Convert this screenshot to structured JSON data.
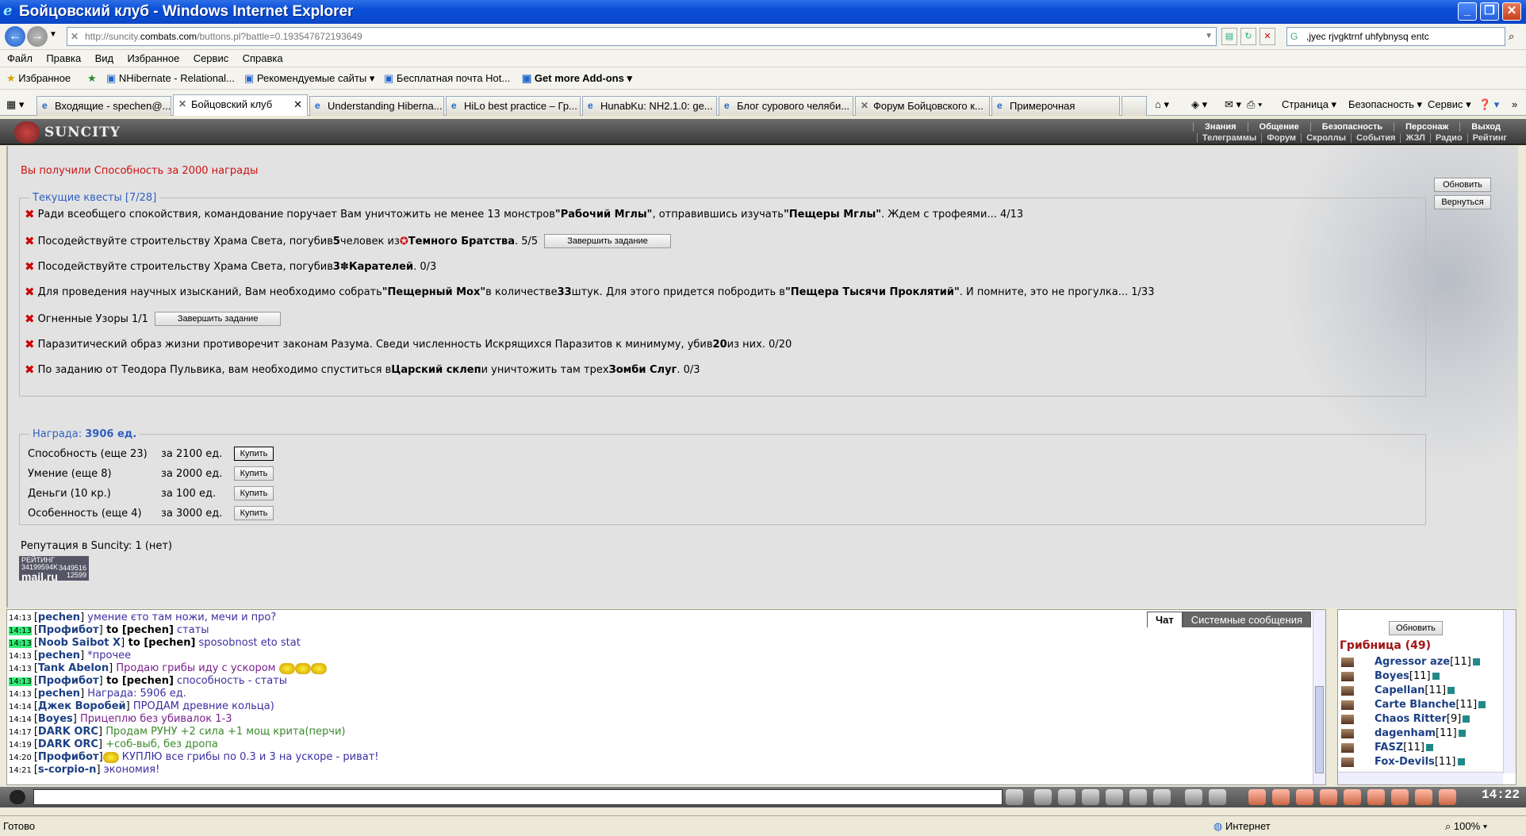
{
  "window": {
    "title": "Бойцовский клуб - Windows Internet Explorer"
  },
  "address": {
    "url_prefix": "http://suncity.",
    "url_domain": "combats.com",
    "url_suffix": "/buttons.pl?battle=0.193547672193649",
    "search_value": ",jyec rjvgktrnf uhfybnysq entc"
  },
  "menu": [
    "Файл",
    "Правка",
    "Вид",
    "Избранное",
    "Сервис",
    "Справка"
  ],
  "favorites": {
    "label": "Избранное",
    "items": [
      "NHibernate - Relational...",
      "Рекомендуемые сайты",
      "Бесплатная почта Hot...",
      "Get more Add-ons"
    ]
  },
  "tabs": [
    "Входящие - spechen@...",
    "Бойцовский клуб",
    "Understanding Hiberna...",
    "HiLo best practice – Гр...",
    "HunabKu: NH2.1.0: ge...",
    "Блог сурового челяби...",
    "Форум Бойцовского к...",
    "Примерочная"
  ],
  "tabtools": {
    "page": "Страница",
    "security": "Безопасность",
    "service": "Сервис"
  },
  "game": {
    "logo": "SUNCITY",
    "nav_top": [
      "Знания",
      "Общение",
      "Безопасность",
      "Персонаж",
      "Выход"
    ],
    "nav_bottom": [
      "Телеграммы",
      "Форум",
      "Скроллы",
      "События",
      "ЖЗЛ",
      "Радио",
      "Рейтинг"
    ]
  },
  "main": {
    "message": "Вы получили Способность за 2000 награды",
    "refresh": "Обновить",
    "back": "Вернуться",
    "quests_legend": "Текущие квесты [7/28]",
    "quests": [
      {
        "a": "Ради всеобщего спокойствия, командование поручает Вам уничтожить не менее 13 монстров ",
        "b": "\"Рабочий Мглы\"",
        "c": ", отправившись изучать ",
        "d": "\"Пещеры Мглы\"",
        "e": ". Ждем с трофеями... 4/13"
      },
      {
        "a": "Посодействуйте строительству Храма Света, погубив ",
        "b": "5",
        "c": " человек из ",
        "d": "Темного Братства",
        "e": ". 5/5",
        "btn": "Завершить задание"
      },
      {
        "a": "Посодействуйте строительству Храма Света, погубив ",
        "b": "3",
        "c": " ",
        "d": "Карателей",
        "e": ". 0/3"
      },
      {
        "a": "Для проведения научных изысканий, Вам необходимо собрать ",
        "b": "\"Пещерный Мох\"",
        "c": " в количестве ",
        "d": "33",
        "e": " штук. Для этого придется побродить в ",
        "f": "\"Пещера Тысячи Проклятий\"",
        "g": ". И помните, это не прогулка... 1/33"
      },
      {
        "a": "Огненные Узоры 1/1",
        "btn": "Завершить задание"
      },
      {
        "a": "Паразитический образ жизни противоречит законам Разума. Сведи численность Искрящихся Паразитов к минимуму, убив ",
        "b": "20",
        "c": " из них. 0/20"
      },
      {
        "a": "По заданию от Теодора Пульвика, вам необходимо спуститься в ",
        "b": "Царский склеп",
        "c": " и уничтожить там трех ",
        "d": "Зомби Слуг",
        "e": ". 0/3"
      }
    ],
    "reward_legend": "Награда: ",
    "reward_value": "3906 ед.",
    "rewards": [
      {
        "name": "Способность (еще 23)",
        "price": "за 2100 ед.",
        "btn": "Купить"
      },
      {
        "name": "Умение (еще 8)",
        "price": "за 2000 ед.",
        "btn": "Купить"
      },
      {
        "name": "Деньги (10 кр.)",
        "price": "за 100 ед.",
        "btn": "Купить"
      },
      {
        "name": "Особенность (еще 4)",
        "price": "за 3000 ед.",
        "btn": "Купить"
      }
    ],
    "reputation": "Репутация в Suncity: 1 (нет)",
    "counter": {
      "top": "РЕЙТИНГ 34199594K",
      "brand": "mail.ru",
      "n1": "3449516",
      "n2": "12599"
    }
  },
  "chat": {
    "tabs": [
      "Чат",
      "Системные сообщения"
    ],
    "lines": [
      {
        "t": "14:13",
        "g": false,
        "n": "pechen",
        "to": "",
        "msg": " умение єто там ножи, мечи и про?",
        "c": "c-navy"
      },
      {
        "t": "14:13",
        "g": true,
        "n": "Профибот",
        "to": " to [pechen]",
        "msg": " статы",
        "c": "c-navy"
      },
      {
        "t": "14:13",
        "g": true,
        "n": "Noob Saibot X",
        "to": " to [pechen]",
        "msg": " sposobnost eto stat",
        "c": "c-navy"
      },
      {
        "t": "14:13",
        "g": false,
        "n": "pechen",
        "to": "",
        "msg": " *прочее",
        "c": "c-navy"
      },
      {
        "t": "14:13",
        "g": false,
        "n": "Tank Abelon",
        "to": "",
        "msg": " Продаю грибы иду с ускором ",
        "c": "c-purple",
        "sm": 3
      },
      {
        "t": "14:13",
        "g": true,
        "n": "Профибот",
        "to": " to [pechen]",
        "msg": " способность - статы",
        "c": "c-navy"
      },
      {
        "t": "14:13",
        "g": false,
        "n": "pechen",
        "to": "",
        "msg": " Награда: 5906 ед.",
        "c": "c-navy"
      },
      {
        "t": "14:14",
        "g": false,
        "n": "Джек Воробей",
        "to": "",
        "msg": " ПРОДАМ древние кольца)",
        "c": "c-navy"
      },
      {
        "t": "14:14",
        "g": false,
        "n": "Boyes",
        "to": "",
        "msg": " Прицеплю без убивалок 1-3",
        "c": "c-purple"
      },
      {
        "t": "14:17",
        "g": false,
        "n": "DARK ORC",
        "to": "",
        "msg": " Продам РУНУ +2 сила +1 мощ крита(перчи)",
        "c": "c-green"
      },
      {
        "t": "14:19",
        "g": false,
        "n": "DARK ORC",
        "to": "",
        "msg": " +соб-выб, без дропа",
        "c": "c-green"
      },
      {
        "t": "14:20",
        "g": false,
        "n": "Профибот",
        "to": "",
        "msg": " КУПЛЮ все грибы по 0.3 и 3 на ускоре - риват!",
        "c": "c-navy",
        "sm": 1
      },
      {
        "t": "14:21",
        "g": false,
        "n": "s-corpio-n",
        "to": "",
        "msg": " экономия!",
        "c": "c-navy"
      }
    ]
  },
  "online": {
    "refresh": "Обновить",
    "room": "Грибница (49)",
    "users": [
      {
        "n": "Agressor aze",
        "l": "[11]"
      },
      {
        "n": "Boyes",
        "l": "[11]"
      },
      {
        "n": "Capellan",
        "l": "[11]"
      },
      {
        "n": "Carte Blanche",
        "l": "[11]"
      },
      {
        "n": "Chaos Ritter",
        "l": "[9]"
      },
      {
        "n": "dagenham",
        "l": "[11]"
      },
      {
        "n": "FASZ",
        "l": "[11]"
      },
      {
        "n": "Fox-Devils",
        "l": "[11]"
      }
    ]
  },
  "clock": "14:22",
  "status": {
    "left": "Готово",
    "zone": "Интернет",
    "zoom": "100%"
  }
}
